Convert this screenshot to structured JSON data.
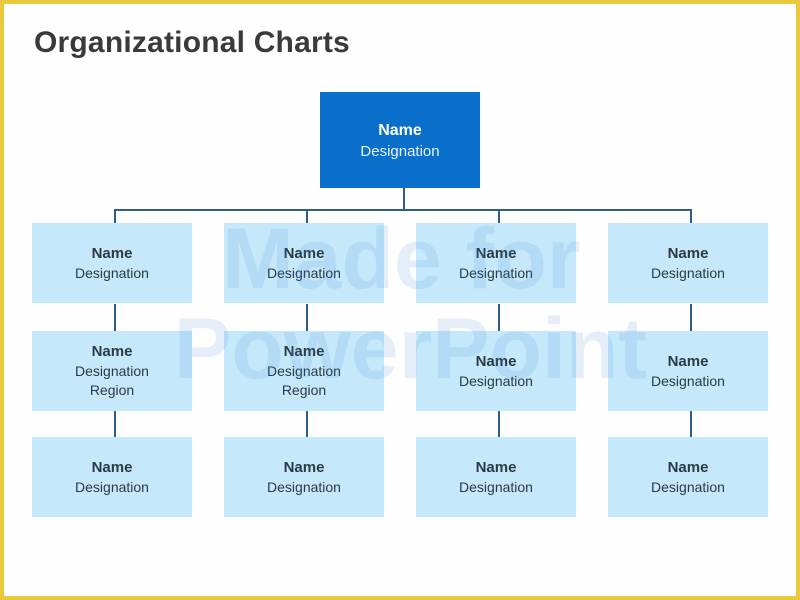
{
  "slide": {
    "title": "Organizational Charts",
    "colors": {
      "frame": "#e8c93a",
      "root_fill": "#0a6fca",
      "node_fill": "#c6e8fb",
      "connector": "#2f5f87",
      "title": "#3a3a3a"
    }
  },
  "root": {
    "name": "Name",
    "designation": "Designation"
  },
  "columns": [
    {
      "level1": {
        "name": "Name",
        "designation": "Designation"
      },
      "level2": {
        "name": "Name",
        "designation": "Designation",
        "region": "Region"
      },
      "level3": {
        "name": "Name",
        "designation": "Designation"
      }
    },
    {
      "level1": {
        "name": "Name",
        "designation": "Designation"
      },
      "level2": {
        "name": "Name",
        "designation": "Designation",
        "region": "Region"
      },
      "level3": {
        "name": "Name",
        "designation": "Designation"
      }
    },
    {
      "level1": {
        "name": "Name",
        "designation": "Designation"
      },
      "level2": {
        "name": "Name",
        "designation": "Designation"
      },
      "level3": {
        "name": "Name",
        "designation": "Designation"
      }
    },
    {
      "level1": {
        "name": "Name",
        "designation": "Designation"
      },
      "level2": {
        "name": "Name",
        "designation": "Designation"
      },
      "level3": {
        "name": "Name",
        "designation": "Designation"
      }
    }
  ],
  "watermark": {
    "line1": "Made for",
    "line2": "PowerPoint"
  }
}
